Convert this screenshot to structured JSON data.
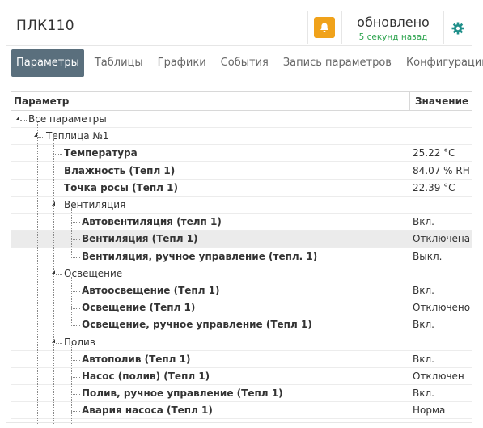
{
  "header": {
    "device_title": "ПЛК110",
    "status_main": "обновлено",
    "status_sub": "5 секунд назад",
    "bell_icon": "bell-icon",
    "settings_icon": "gear-icon",
    "accent": "#f0a21a",
    "status_color": "#2ea44f"
  },
  "tabs": [
    {
      "label": "Параметры",
      "active": true
    },
    {
      "label": "Таблицы",
      "active": false
    },
    {
      "label": "Графики",
      "active": false
    },
    {
      "label": "События",
      "active": false
    },
    {
      "label": "Запись параметров",
      "active": false
    },
    {
      "label": "Конфигурации",
      "active": false
    }
  ],
  "table": {
    "headers": {
      "param": "Параметр",
      "value": "Значение"
    },
    "rows": [
      {
        "label": "Все параметры",
        "value": "",
        "bold": false,
        "level": 0,
        "group": true
      },
      {
        "label": "Теплица №1",
        "value": "",
        "bold": false,
        "level": 1,
        "group": true
      },
      {
        "label": "Температура",
        "value": "25.22 °C",
        "bold": true,
        "level": 2,
        "group": false
      },
      {
        "label": "Влажность (Тепл 1)",
        "value": "84.07 % RH",
        "bold": true,
        "level": 2,
        "group": false
      },
      {
        "label": "Точка росы (Тепл 1)",
        "value": "22.39 °C",
        "bold": true,
        "level": 2,
        "group": false
      },
      {
        "label": "Вентиляция",
        "value": "",
        "bold": false,
        "level": 2,
        "group": true
      },
      {
        "label": "Автовентиляция (телп 1)",
        "value": "Вкл.",
        "bold": true,
        "level": 3,
        "group": false
      },
      {
        "label": "Вентиляция (Тепл 1)",
        "value": "Отключена",
        "bold": true,
        "level": 3,
        "group": false,
        "highlight": true
      },
      {
        "label": "Вентиляция, ручное управление (тепл. 1)",
        "value": "Выкл.",
        "bold": true,
        "level": 3,
        "group": false
      },
      {
        "label": "Освещение",
        "value": "",
        "bold": false,
        "level": 2,
        "group": true
      },
      {
        "label": "Автоосвещение (Тепл 1)",
        "value": "Вкл.",
        "bold": true,
        "level": 3,
        "group": false
      },
      {
        "label": "Освещение (Тепл 1)",
        "value": "Отключено",
        "bold": true,
        "level": 3,
        "group": false
      },
      {
        "label": "Освещение, ручное управление (Тепл 1)",
        "value": "Вкл.",
        "bold": true,
        "level": 3,
        "group": false
      },
      {
        "label": "Полив",
        "value": "",
        "bold": false,
        "level": 2,
        "group": true
      },
      {
        "label": "Автополив (Тепл 1)",
        "value": "Вкл.",
        "bold": true,
        "level": 3,
        "group": false
      },
      {
        "label": "Насос (полив) (Тепл 1)",
        "value": "Отключен",
        "bold": true,
        "level": 3,
        "group": false
      },
      {
        "label": "Полив, ручное управление (Тепл 1)",
        "value": "Вкл.",
        "bold": true,
        "level": 3,
        "group": false
      },
      {
        "label": "Авария насоса (Тепл 1)",
        "value": "Норма",
        "bold": true,
        "level": 3,
        "group": false
      }
    ]
  }
}
